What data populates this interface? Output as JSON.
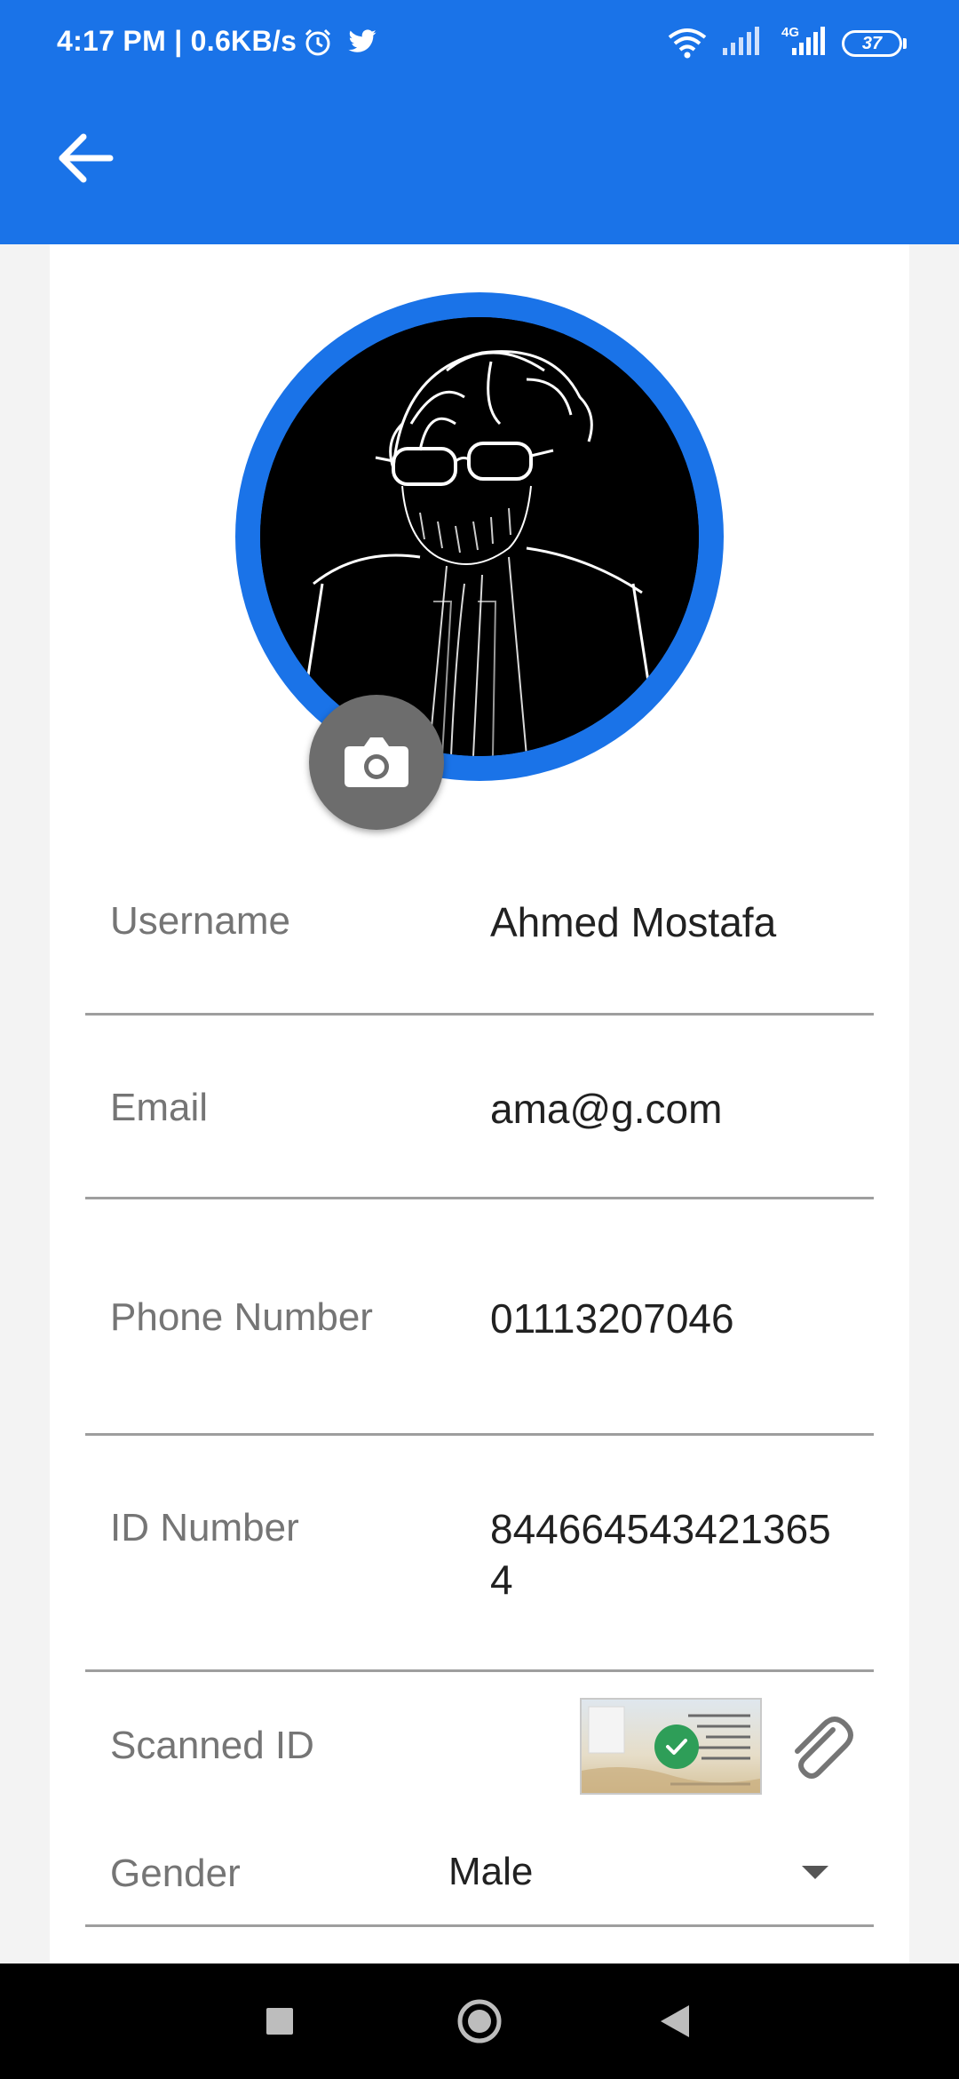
{
  "status_bar": {
    "time": "4:17 PM | 0.6KB/s",
    "network": "4G",
    "battery": "37"
  },
  "app_bar": {
    "back_icon": "arrow-back-icon"
  },
  "profile": {
    "avatar_icon": "profile-avatar",
    "camera_icon": "camera-icon"
  },
  "fields": {
    "username": {
      "label": "Username",
      "value": "Ahmed Mostafa"
    },
    "email": {
      "label": "Email",
      "value": "ama@g.com"
    },
    "phone": {
      "label": "Phone Number",
      "value": "01113207046"
    },
    "id_number": {
      "label": "ID Number",
      "value": "8446645434213654"
    },
    "scanned_id": {
      "label": "Scanned ID",
      "attach_icon": "paperclip-icon",
      "status_icon": "check-icon"
    },
    "gender": {
      "label": "Gender",
      "value": "Male",
      "icon": "dropdown-arrow-icon"
    }
  },
  "colors": {
    "primary": "#1a73e8",
    "success": "#2e9e58",
    "camera_button": "#6d6d6d"
  },
  "nav_bar": {
    "icons": [
      "recent-apps-icon",
      "home-icon",
      "back-icon"
    ]
  }
}
